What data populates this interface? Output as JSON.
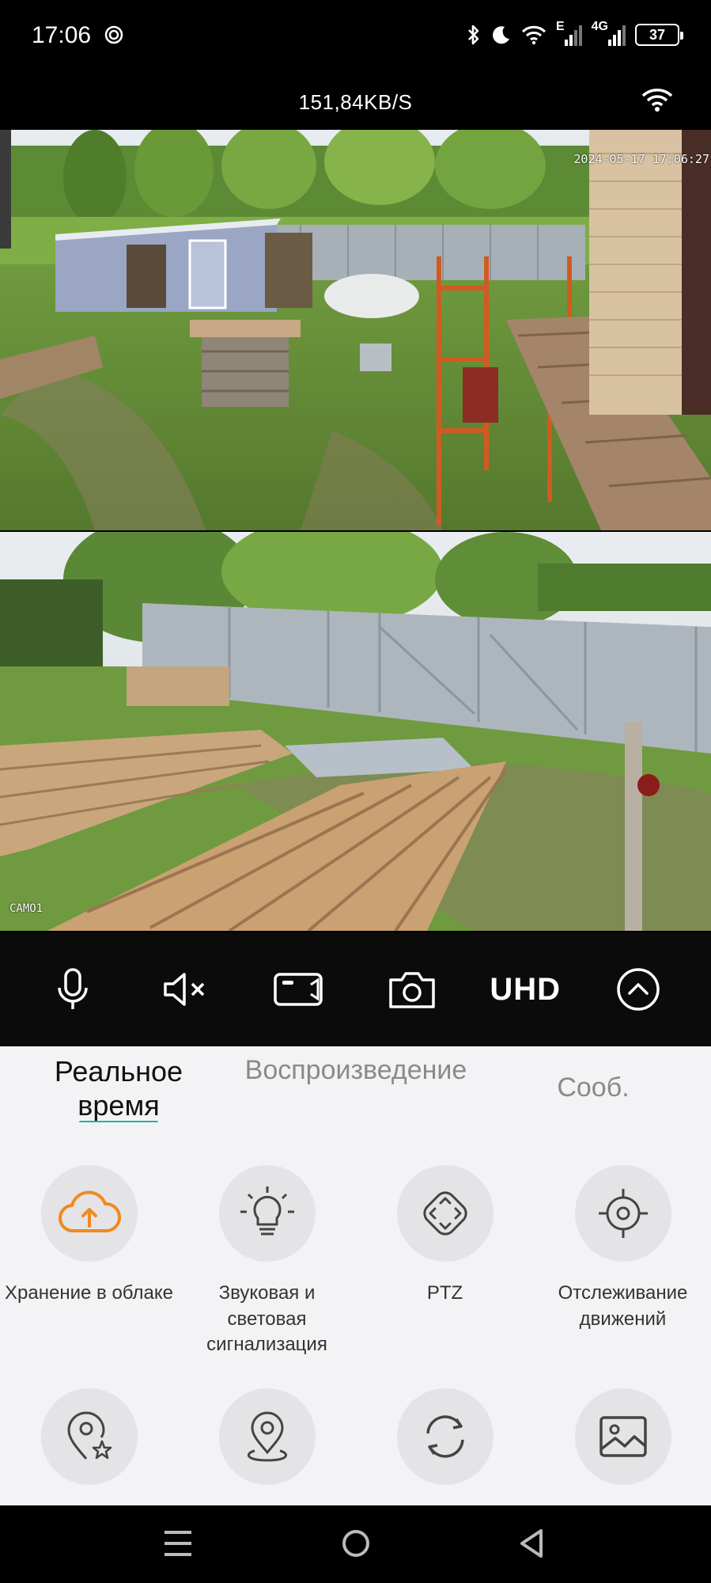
{
  "status_bar": {
    "time": "17:06",
    "network_e": "E",
    "network_4g": "4G",
    "battery": "37"
  },
  "header": {
    "speed": "151,84KB/S"
  },
  "feeds": [
    {
      "timestamp": "2024-05-17 17:06:27"
    },
    {
      "label": "CAMO1"
    }
  ],
  "controls": {
    "quality_label": "UHD",
    "icons": [
      "microphone-icon",
      "speaker-mute-icon",
      "video-record-icon",
      "camera-snapshot-icon",
      "chevron-up-icon"
    ]
  },
  "tabs": [
    {
      "label": "Реальное время",
      "active": true
    },
    {
      "label": "Воспроизведение"
    },
    {
      "label": "Сооб."
    }
  ],
  "features": [
    {
      "label": "Хранение в облаке",
      "icon": "cloud-upload-icon"
    },
    {
      "label": "Звуковая и световая сигнализация",
      "icon": "light-alarm-icon"
    },
    {
      "label": "PTZ",
      "icon": "ptz-icon"
    },
    {
      "label": "Отслеживание движений",
      "icon": "motion-tracking-icon"
    },
    {
      "label": "",
      "icon": "favorite-location-icon"
    },
    {
      "label": "",
      "icon": "location-pin-icon"
    },
    {
      "label": "",
      "icon": "rotate-icon"
    },
    {
      "label": "",
      "icon": "gallery-icon"
    }
  ],
  "colors": {
    "accent": "#1db5a8",
    "cloud_icon": "#f08a1c"
  }
}
